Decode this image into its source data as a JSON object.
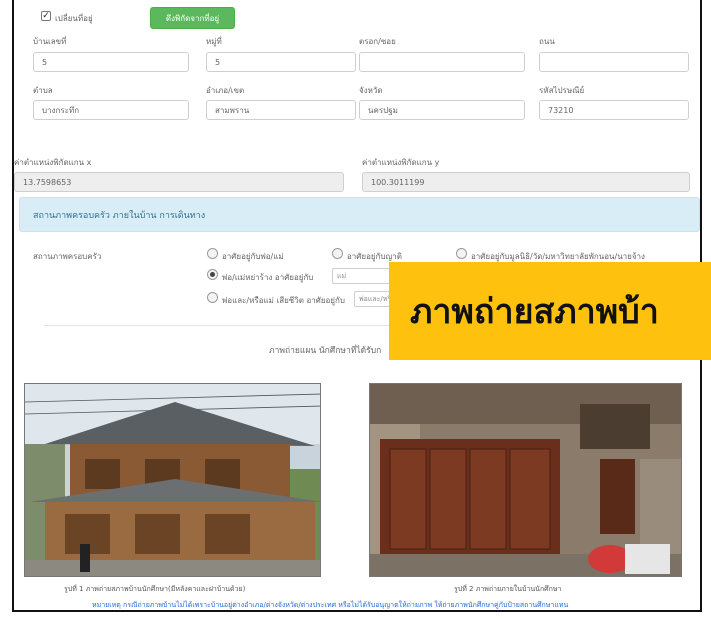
{
  "address": {
    "change_checkbox_label": "เปลี่ยนที่อยู่",
    "pull_coords_button": "ดึงพิกัดจากที่อยู่",
    "house_no": {
      "label": "บ้านเลขที่",
      "value": "5"
    },
    "moo": {
      "label": "หมู่ที่",
      "value": "5"
    },
    "soi": {
      "label": "ตรอก/ซอย",
      "value": ""
    },
    "road": {
      "label": "ถนน",
      "value": ""
    },
    "tambon": {
      "label": "ตำบล",
      "value": "บางกระทึก"
    },
    "amphoe": {
      "label": "อำเภอ/เขต",
      "value": "สามพราน"
    },
    "province": {
      "label": "จังหวัด",
      "value": "นครปฐม"
    },
    "postcode": {
      "label": "รหัสไปรษณีย์",
      "value": "73210"
    }
  },
  "coordinates": {
    "x_label": "ค่าตำแหน่งพิกัดแกน x",
    "x_value": "13.7598653",
    "y_label": "ค่าตำแหน่งพิกัดแกน y",
    "y_value": "100.3011199"
  },
  "info_bar": "สถานภาพครอบครัว ภายในบ้าน การเดินทาง",
  "family_status": {
    "label": "สถานภาพครอบครัว",
    "options": [
      "อาศัยอยู่กับพ่อ/แม่",
      "อาศัยอยู่กับญาติ",
      "อาศัยอยู่กับมูลนิธิ/วัด/มหาวิทยาลัยพักนอน/นายจ้าง",
      "พ่อ/แม่หย่าร้าง อาศัยอยู่กับ",
      "พ่อและ/หรือแม่ เสียชีวิต อาศัยอยู่กับ"
    ],
    "divorced_with_value": "แม่",
    "deceased_with_value": "พ่อและ/หรือแม่"
  },
  "banner_text": "ภาพถ่ายสภาพบ้า",
  "photo_section_title": "ภาพถ่ายแผน นักศึกษาที่ได้รับก",
  "photos": {
    "caption1": "รูปที่ 1 ภาพถ่ายสภาพบ้านนักศึกษา(มีหลังคาและฝาบ้านด้วย)",
    "caption2": "รูปที่ 2 ภาพถ่ายภายในบ้านนักศึกษา"
  },
  "note": "หมายเหตุ กรณีถ่ายภาพบ้านไม่ได้เพราะบ้านอยู่ต่างอำเภอ/ต่างจังหวัด/ต่างประเทศ หรือไม่ได้รับอนุญาตให้ถ่ายภาพ ให้ถ่ายภาพนักศึกษาคู่กับป้ายสถานศึกษาแทน",
  "colors": {
    "green_button": "#5cb85c",
    "info_bg": "#d9edf7",
    "info_text": "#31708f",
    "banner": "#fec10e",
    "note_text": "#2a6ad6"
  }
}
